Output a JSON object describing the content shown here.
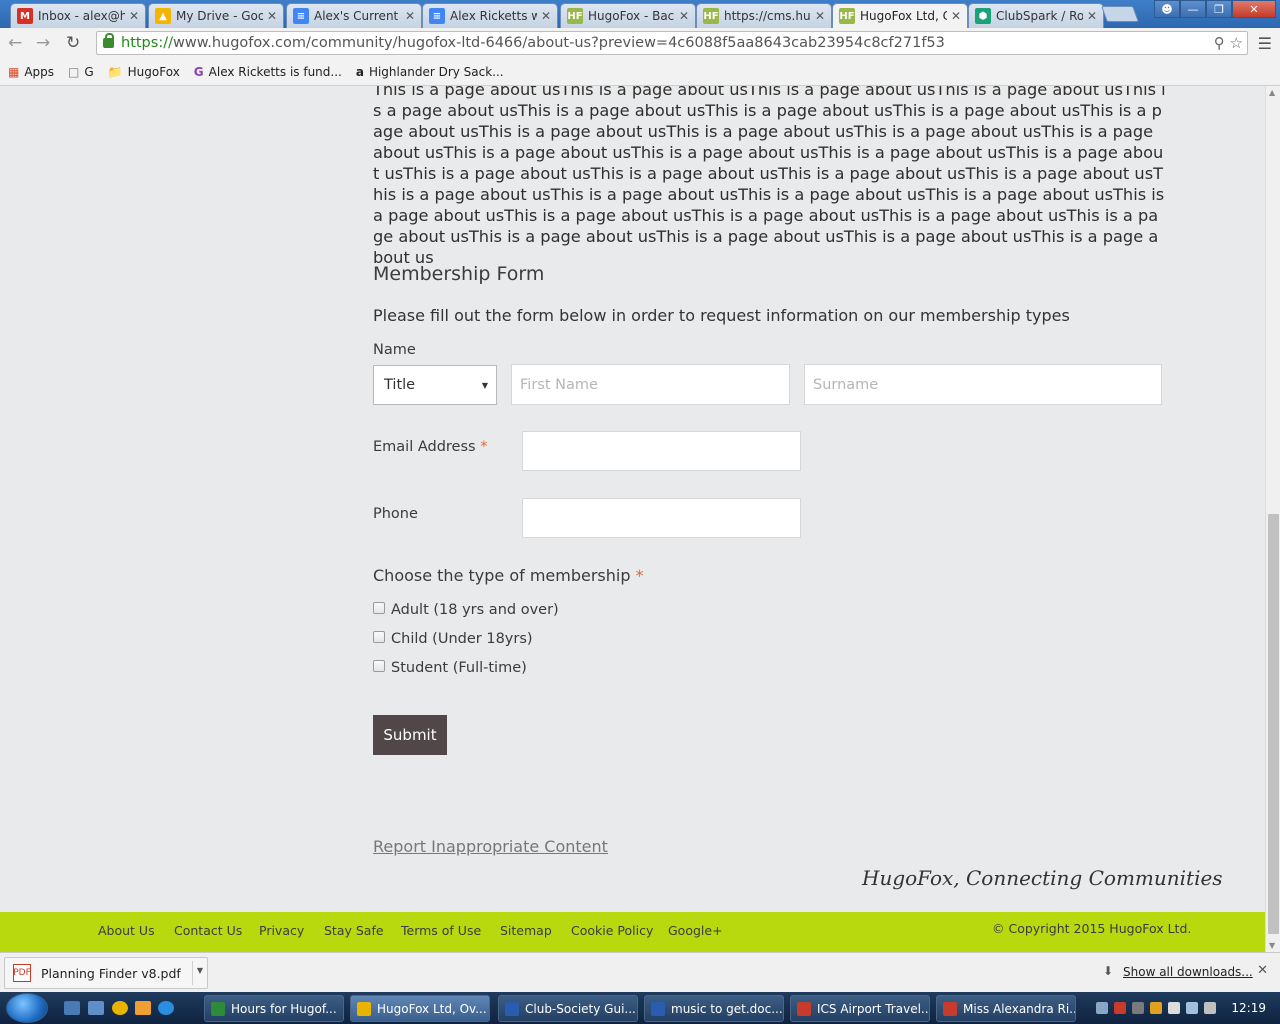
{
  "browser": {
    "tabs": [
      {
        "title": "Inbox - alex@hugofox.com",
        "favicon": "gmail-icon",
        "color": "#d93025",
        "glyph": "M"
      },
      {
        "title": "My Drive - Google Drive",
        "favicon": "drive-icon",
        "color": "#f4b400",
        "glyph": "▲"
      },
      {
        "title": "Alex's Current Projects",
        "favicon": "docs-icon",
        "color": "#4285f4",
        "glyph": "≡"
      },
      {
        "title": "Alex Ricketts work",
        "favicon": "docs-icon",
        "color": "#4285f4",
        "glyph": "≡"
      },
      {
        "title": "HugoFox - Backend",
        "favicon": "hugofox-icon",
        "color": "#9ab84a",
        "glyph": "HF"
      },
      {
        "title": "https://cms.hugofox",
        "favicon": "hugofox-icon",
        "color": "#9ab84a",
        "glyph": "HF"
      },
      {
        "title": "HugoFox Ltd, Community",
        "favicon": "hugofox-icon",
        "color": "#9ab84a",
        "glyph": "HF"
      },
      {
        "title": "ClubSpark / Roper",
        "favicon": "clubspark-icon",
        "color": "#1aa37a",
        "glyph": "⬢"
      }
    ],
    "active_tab": 6,
    "url_proto": "https://",
    "url_rest": "www.hugofox.com/community/hugofox-ltd-6466/about-us?preview=4c6088f5aa8643cab23954c8cf271f53",
    "bookmarks": [
      {
        "label": "Apps",
        "icon": "apps-grid-icon"
      },
      {
        "label": "G",
        "icon": "page-icon"
      },
      {
        "label": "HugoFox",
        "icon": "folder-icon"
      },
      {
        "label": "Alex Ricketts is fund...",
        "icon": "g-icon"
      },
      {
        "label": "Highlander Dry Sack...",
        "icon": "amazon-icon"
      }
    ]
  },
  "page": {
    "about_text": "This is a page about usThis is a page about usThis is a page about usThis is a page about usThis is a page about usThis is a page about usThis is a page about usThis is a page about usThis is a page about usThis is a page about usThis is a page about usThis is a page about usThis is a page about usThis is a page about usThis is a page about usThis is a page about usThis is a page about usThis is a page about usThis is a page about usThis is a page about usThis is a page about usThis is a page about usThis is a page about usThis is a page about usThis is a page about usThis is a page about usThis is a page about usThis is a page about usThis is a page about usThis is a page about usThis is a page about usThis is a page about usThis is a page about usThis is a page about us",
    "form_title": "Membership Form",
    "form_desc": "Please fill out the form below in order to request information on our membership types",
    "name_label": "Name",
    "title_select": "Title",
    "first_name_placeholder": "First Name",
    "surname_placeholder": "Surname",
    "email_label": "Email Address",
    "phone_label": "Phone",
    "membership_label": "Choose the type of membership",
    "required_mark": "*",
    "options": [
      "Adult (18 yrs and over)",
      "Child (Under 18yrs)",
      "Student (Full-time)"
    ],
    "submit_label": "Submit",
    "report_link": "Report Inappropriate Content",
    "tagline": "HugoFox, Connecting Communities"
  },
  "footer": {
    "links": [
      "About Us",
      "Contact Us",
      "Privacy",
      "Stay Safe",
      "Terms of Use",
      "Sitemap",
      "Cookie Policy",
      "Google+"
    ],
    "copyright": "© Copyright 2015 HugoFox Ltd.",
    "color": "#b9d90f"
  },
  "downloads": {
    "file": "Planning Finder v8.pdf",
    "show_all": "Show all downloads..."
  },
  "taskbar": {
    "tasks": [
      {
        "label": "Hours for Hugof...",
        "color": "#2e8b3a"
      },
      {
        "label": "HugoFox Ltd, Ov...",
        "color": "#e8b400"
      },
      {
        "label": "Club-Society Gui...",
        "color": "#2a5db0"
      },
      {
        "label": "music to get.doc...",
        "color": "#2a5db0"
      },
      {
        "label": "ICS Airport Travel...",
        "color": "#c63b2c"
      },
      {
        "label": "Miss Alexandra Ri...",
        "color": "#c63b2c"
      }
    ],
    "clock": "12:19"
  }
}
